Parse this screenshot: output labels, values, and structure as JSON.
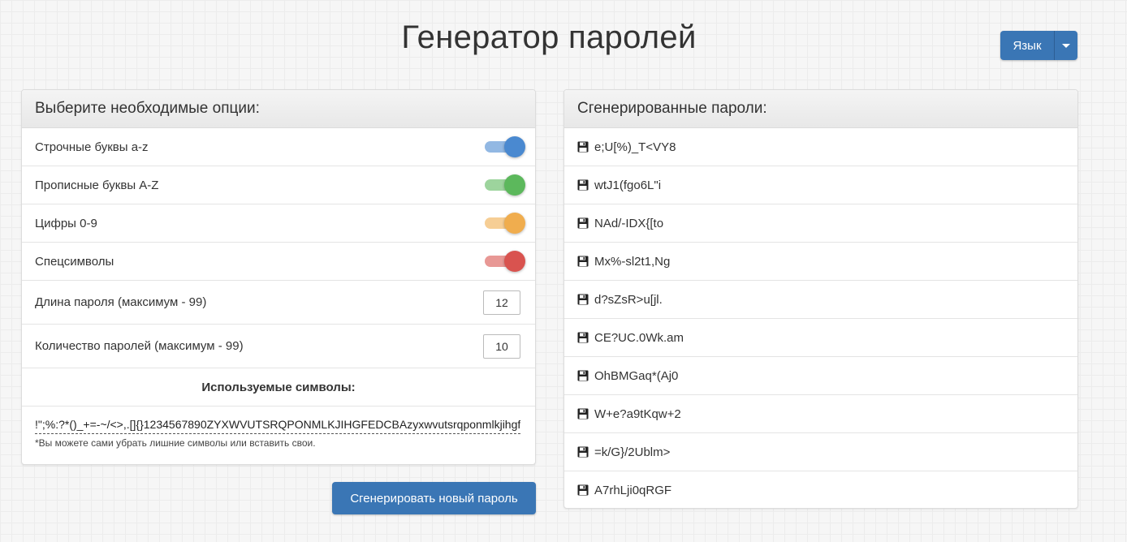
{
  "header": {
    "title": "Генератор паролей"
  },
  "language_button": {
    "label": "Язык"
  },
  "options_panel": {
    "title": "Выберите необходимые опции:",
    "toggles": [
      {
        "label": "Строчные буквы a-z",
        "enabled": true,
        "color": "#4a89d0"
      },
      {
        "label": "Прописные буквы A-Z",
        "enabled": true,
        "color": "#5cb85c"
      },
      {
        "label": "Цифры 0-9",
        "enabled": true,
        "color": "#f0ad4e"
      },
      {
        "label": "Спецсимволы",
        "enabled": true,
        "color": "#d9534f"
      }
    ],
    "length": {
      "label": "Длина пароля (максимум - 99)",
      "value": "12"
    },
    "count": {
      "label": "Количество паролей (максимум - 99)",
      "value": "10"
    },
    "symbols": {
      "title": "Используемые символы:",
      "value": "!\";%:?*()_+=-~/<>,.[]{}1234567890ZYXWVUTSRQPONMLKJIHGFEDCBAzyxwvutsrqponmlkjihgfedcba",
      "note": "*Вы можете сами убрать лишние символы или вставить свои."
    }
  },
  "generate_button": {
    "label": "Сгенерировать новый пароль"
  },
  "passwords_panel": {
    "title": "Сгенерированные пароли:",
    "passwords": [
      "e;U[%)_T<VY8",
      "wtJ1(fgo6L\"i",
      "NAd/-IDX{[to",
      "Mx%-sl2t1,Ng",
      "d?sZsR>u[jl.",
      "CE?UC.0Wk.am",
      "OhBMGaq*(Aj0",
      "W+e?a9tKqw+2",
      "=k/G}/2Ublm>",
      "A7rhLji0qRGF"
    ]
  },
  "colors": {
    "accent": "#3a76b5"
  },
  "icons": {
    "password_row": "floppy-disk-icon",
    "language_dropdown": "chevron-down-icon"
  }
}
